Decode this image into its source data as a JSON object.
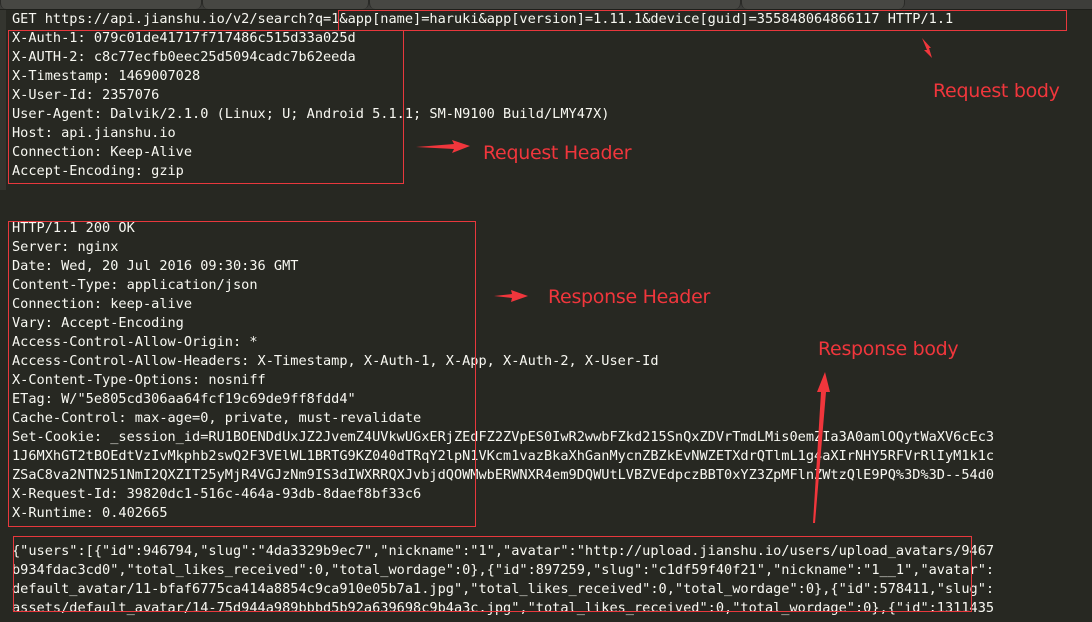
{
  "request": {
    "request_line_prefix": "GET https://api.jianshu.io/v2/search?",
    "request_line_query": "q=1&app[name]=haruki&app[version]=1.11.1&device[guid]=355848064866117 HTTP/1.1",
    "headers": [
      "X-Auth-1: 079c01de41717f717486c515d33a025d",
      "X-AUTH-2: c8c77ecfb0eec25d5094cadc7b62eeda",
      "X-Timestamp: 1469007028",
      "X-User-Id: 2357076",
      "User-Agent: Dalvik/2.1.0 (Linux; U; Android 5.1.1; SM-N9100 Build/LMY47X)",
      "Host: api.jianshu.io",
      "Connection: Keep-Alive",
      "Accept-Encoding: gzip"
    ]
  },
  "response": {
    "headers": [
      "HTTP/1.1 200 OK",
      "Server: nginx",
      "Date: Wed, 20 Jul 2016 09:30:36 GMT",
      "Content-Type: application/json",
      "Connection: keep-alive",
      "Vary: Accept-Encoding",
      "Access-Control-Allow-Origin: *",
      "Access-Control-Allow-Headers: X-Timestamp, X-Auth-1, X-App, X-Auth-2, X-User-Id",
      "X-Content-Type-Options: nosniff",
      "ETag: W/\"5e805cd306aa64fcf19c69de9ff8fdd4\"",
      "Cache-Control: max-age=0, private, must-revalidate",
      "Set-Cookie: _session_id=RU1BOENDdUxJZ2JvemZ4UVkwUGxERjZEdFZ2ZVpES0IwR2wwbFZkd215SnQxZDVrTmdLMis0emZIa3A0amlOQytWaXV6cEc3",
      "1J6MXhGT2tBOEdtVzIvMkphb2swQ2F3VElWL1BRTG9KZ040dTRqY2lpN1VKcm1vazBkaXhGanMycnZBZkEvNWZETXdrQTlmL1g4aXIrNHY5RFVrRlIyM1k1c",
      "ZSaC8va2NTN251NmI2QXZIT25yMjR4VGJzNm9IS3dIWXRRQXJvbjdQOWMwbERWNXR4em9DQWUtLVBZVEdpczBBT0xYZ3ZpMFlnZWtzQlE9PQ%3D%3D--54d0",
      "X-Request-Id: 39820dc1-516c-464a-93db-8daef8bf33c6",
      "X-Runtime: 0.402665"
    ],
    "body_lines": [
      "{\"users\":[{\"id\":946794,\"slug\":\"4da3329b9ec7\",\"nickname\":\"1\",\"avatar\":\"http://upload.jianshu.io/users/upload_avatars/9467",
      "b934fdac3cd0\",\"total_likes_received\":0,\"total_wordage\":0},{\"id\":897259,\"slug\":\"c1df59f40f21\",\"nickname\":\"1__1\",\"avatar\":",
      "default_avatar/11-bfaf6775ca414a8854c9ca910e05b7a1.jpg\",\"total_likes_received\":0,\"total_wordage\":0},{\"id\":578411,\"slug\":",
      "assets/default_avatar/14-75d944a989bbbd5b92a639698c9b4a3c.jpg\",\"total_likes_received\":0,\"total_wordage\":0},{\"id\":1311435"
    ]
  },
  "annotations": {
    "request_body": "Request body",
    "request_header": "Request Header",
    "response_header": "Response Header",
    "response_body": "Response body"
  },
  "colors": {
    "background": "#272822",
    "text": "#f8f8f2",
    "annotation": "#f0363c"
  }
}
